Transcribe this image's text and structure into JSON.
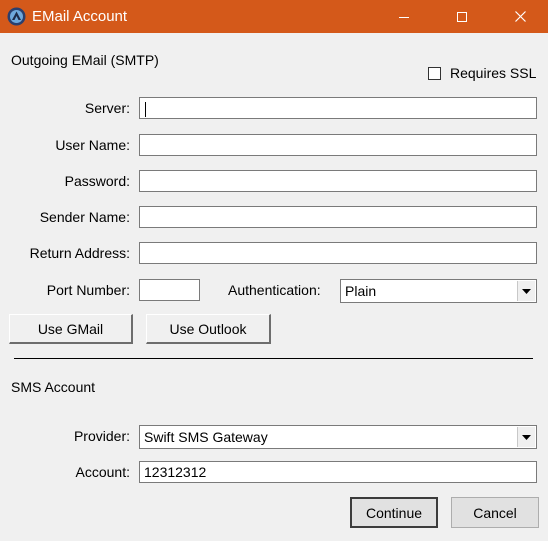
{
  "window": {
    "title": "EMail Account",
    "titlebar_color": "#d4591a",
    "controls": {
      "minimize": "minimize-icon",
      "maximize": "maximize-icon",
      "close": "close-icon"
    }
  },
  "smtp": {
    "section_label": "Outgoing EMail (SMTP)",
    "requires_ssl": {
      "label": "Requires SSL",
      "checked": false
    },
    "server_label": "Server:",
    "server_value": "",
    "username_label": "User Name:",
    "username_value": "",
    "password_label": "Password:",
    "password_value": "",
    "sender_name_label": "Sender Name:",
    "sender_name_value": "",
    "return_address_label": "Return Address:",
    "return_address_value": "",
    "port_label": "Port Number:",
    "port_value": "",
    "auth_label": "Authentication:",
    "auth_value": "Plain",
    "use_gmail_label": "Use GMail",
    "use_outlook_label": "Use Outlook"
  },
  "sms": {
    "section_label": "SMS Account",
    "provider_label": "Provider:",
    "provider_value": "Swift SMS Gateway",
    "account_label": "Account:",
    "account_value": "12312312"
  },
  "footer": {
    "continue_label": "Continue",
    "cancel_label": "Cancel"
  }
}
